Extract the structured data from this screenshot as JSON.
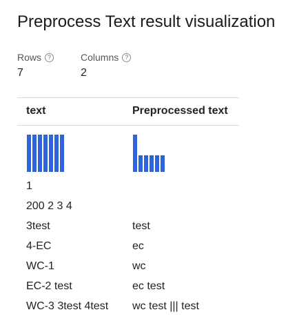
{
  "title": "Preprocess Text result visualization",
  "stats": {
    "rows": {
      "label": "Rows",
      "value": "7"
    },
    "columns": {
      "label": "Columns",
      "value": "2"
    }
  },
  "help_glyph": "?",
  "colors": {
    "accent": "#2e63d9",
    "divider": "#d9d9d9",
    "text": "#222222"
  },
  "columns": [
    {
      "header": "text",
      "histogram": [
        1,
        1,
        1,
        1,
        1,
        1,
        1
      ]
    },
    {
      "header": "Preprocessed text",
      "histogram": [
        1,
        0.45,
        0.45,
        0.45,
        0.45,
        0.45
      ]
    }
  ],
  "rows": [
    {
      "text": "1",
      "preprocessed": ""
    },
    {
      "text": "200 2 3 4",
      "preprocessed": ""
    },
    {
      "text": "3test",
      "preprocessed": "test"
    },
    {
      "text": "4-EC",
      "preprocessed": "ec"
    },
    {
      "text": "WC-1",
      "preprocessed": "wc"
    },
    {
      "text": "EC-2 test",
      "preprocessed": "ec test"
    },
    {
      "text": "WC-3 3test 4test",
      "preprocessed": "wc test ||| test"
    }
  ]
}
